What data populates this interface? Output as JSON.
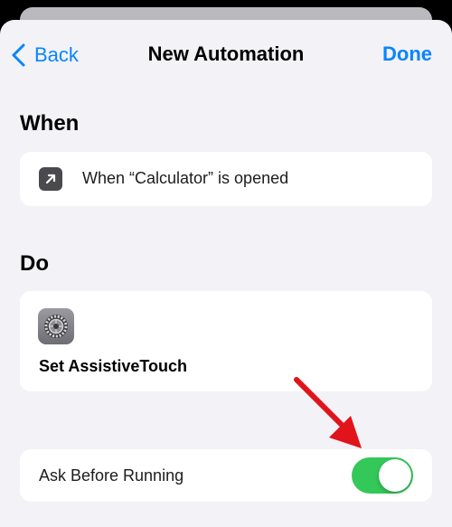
{
  "nav": {
    "back_label": "Back",
    "title": "New Automation",
    "done_label": "Done"
  },
  "when": {
    "section_title": "When",
    "trigger_text": "When “Calculator” is opened",
    "trigger_icon": "open-app-arrow-icon"
  },
  "do": {
    "section_title": "Do",
    "action_icon": "settings-gear-icon",
    "action_label": "Set AssistiveTouch"
  },
  "ask_before_running": {
    "label": "Ask Before Running",
    "enabled": true
  },
  "colors": {
    "accent": "#0a84ff",
    "toggle_on": "#34c759",
    "annotation": "#e0141a"
  }
}
